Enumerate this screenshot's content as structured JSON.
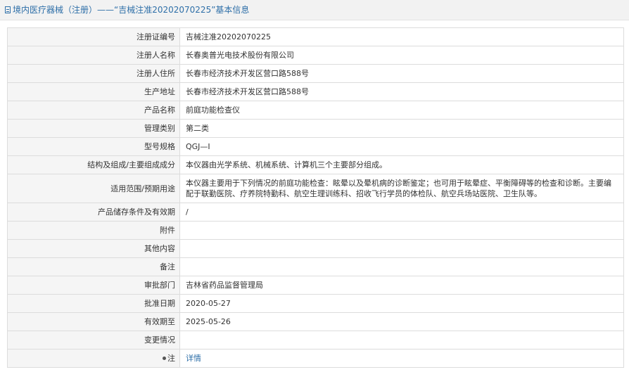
{
  "header": {
    "title": "境内医疗器械（注册）——“吉械注准20202070225”基本信息",
    "icon": "document-icon"
  },
  "rows": [
    {
      "label": "注册证编号",
      "value": "吉械注准20202070225"
    },
    {
      "label": "注册人名称",
      "value": "长春奥普光电技术股份有限公司"
    },
    {
      "label": "注册人住所",
      "value": "长春市经济技术开发区营口路588号"
    },
    {
      "label": "生产地址",
      "value": "长春市经济技术开发区营口路588号"
    },
    {
      "label": "产品名称",
      "value": "前庭功能检查仪"
    },
    {
      "label": "管理类别",
      "value": "第二类"
    },
    {
      "label": "型号规格",
      "value": "QGJ—Ⅰ"
    },
    {
      "label": "结构及组成/主要组成成分",
      "value": "本仪器由光学系统、机械系统、计算机三个主要部分组成。"
    },
    {
      "label": "适用范围/预期用途",
      "value": "本仪器主要用于下列情况的前庭功能检查：眩晕以及晕机病的诊断鉴定；也可用于眩晕症、平衡障碍等的检查和诊断。主要编配于联勤医院、疗养院特勤科、航空生理训练科、招收飞行学员的体检队、航空兵场站医院、卫生队等。"
    },
    {
      "label": "产品储存条件及有效期",
      "value": "/"
    },
    {
      "label": "附件",
      "value": ""
    },
    {
      "label": "其他内容",
      "value": ""
    },
    {
      "label": "备注",
      "value": ""
    },
    {
      "label": "审批部门",
      "value": "吉林省药品监督管理局"
    },
    {
      "label": "批准日期",
      "value": "2020-05-27"
    },
    {
      "label": "有效期至",
      "value": "2025-05-26"
    },
    {
      "label": "变更情况",
      "value": ""
    },
    {
      "label": "注",
      "value": "详情",
      "icon": "pin-icon"
    }
  ],
  "colors": {
    "link": "#2e6fa8",
    "label_bg": "#f5f5f5",
    "border": "#dcdcdc"
  }
}
